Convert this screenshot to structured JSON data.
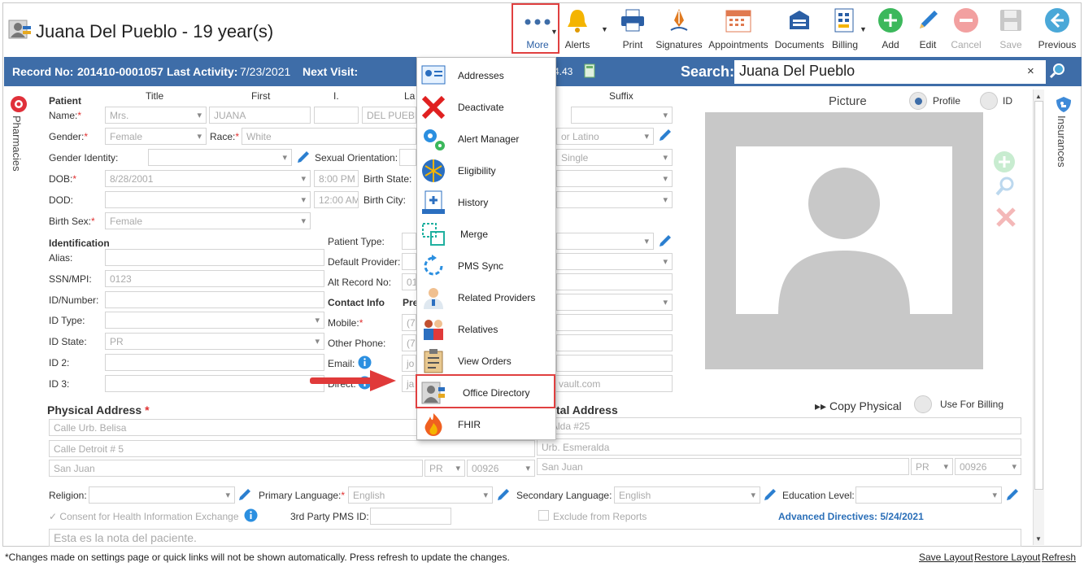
{
  "header": {
    "title": "Juana Del Pueblo - 19 year(s)"
  },
  "toolbar": {
    "more": "More",
    "alerts": "Alerts",
    "print": "Print",
    "signatures": "Signatures",
    "appointments": "Appointments",
    "documents": "Documents",
    "billing": "Billing",
    "add": "Add",
    "edit": "Edit",
    "cancel": "Cancel",
    "save": "Save",
    "previous": "Previous"
  },
  "infobar": {
    "record_label": "Record No:",
    "record_value": "201410-0001057",
    "activity_label": "Last Activity:",
    "activity_value": "7/23/2021",
    "next_label": "Next Visit:",
    "balance_tail": "4.43",
    "search_label": "Search:",
    "search_value": "Juana Del Pueblo",
    "close": "×"
  },
  "side": {
    "left": "Pharmacies",
    "right": "Insurances"
  },
  "patient": {
    "section": "Patient",
    "col_title": "Title",
    "col_first": "First",
    "col_i": "I.",
    "col_last": "La",
    "col_suffix": "Suffix",
    "name_label": "Name:",
    "title_value": "Mrs.",
    "first_value": "JUANA",
    "last_value": "DEL PUEBLO",
    "gender_label": "Gender:",
    "gender_value": "Female",
    "race_label": "Race:",
    "race_value": "White",
    "ethnicity_tail": "or Latino",
    "gender_identity_label": "Gender Identity:",
    "sexual_orientation_label": "Sexual Orientation:",
    "marital_value": "Single",
    "dob_label": "DOB:",
    "dob_value": "8/28/2001",
    "dob_time": "8:00 PM",
    "birth_state_label": "Birth State:",
    "dod_label": "DOD:",
    "dod_time": "12:00 AM",
    "birth_city_label": "Birth City:",
    "birth_sex_label": "Birth Sex:",
    "birth_sex_value": "Female"
  },
  "identification": {
    "section": "Identification",
    "alias_label": "Alias:",
    "ssn_label": "SSN/MPI:",
    "ssn_value": "0123",
    "idnumber_label": "ID/Number:",
    "idtype_label": "ID Type:",
    "idstate_label": "ID State:",
    "idstate_value": "PR",
    "id2_label": "ID 2:",
    "id3_label": "ID 3:"
  },
  "misc": {
    "patient_type_label": "Patient Type:",
    "default_provider_label": "Default Provider:",
    "alt_record_label": "Alt Record No:",
    "alt_record_tail": "01",
    "contact_label": "Contact Info",
    "contact_pref": "Pre",
    "mobile_label": "Mobile:",
    "mobile_tail": "(7",
    "other_phone_label": "Other Phone:",
    "other_phone_tail": "(7",
    "email_label": "Email:",
    "email_tail": "jo",
    "direct_label": "Direct:",
    "direct_tail": "ja",
    "direct_domain_tail": "vault.com"
  },
  "picture": {
    "label": "Picture",
    "profile": "Profile",
    "id": "ID"
  },
  "physical": {
    "label": "Physical Address",
    "line1": "Calle Urb. Belisa",
    "line2": "Calle Detroit # 5",
    "city": "San Juan",
    "state": "PR",
    "zip": "00926"
  },
  "postal": {
    "label_tail": "tal Address",
    "copy": "Copy Physical",
    "use_billing": "Use For Billing",
    "line1_tail": "le Alda #25",
    "line2": "Urb. Esmeralda",
    "city": "San Juan",
    "state": "PR",
    "zip": "00926"
  },
  "bottom": {
    "religion_label": "Religion:",
    "primary_lang_label": "Primary Language:",
    "primary_lang_value": "English",
    "secondary_lang_label": "Secondary Language:",
    "secondary_lang_value": "English",
    "education_label": "Education Level:",
    "consent": "Consent for Health Information Exchange",
    "third_party_label": "3rd Party PMS ID:",
    "exclude": "Exclude from Reports",
    "adv_directives": "Advanced Directives: 5/24/2021",
    "note": "Esta es la nota del paciente."
  },
  "menu": {
    "items": [
      "Addresses",
      "Deactivate",
      "Alert Manager",
      "Eligibility",
      "History",
      "Merge",
      "PMS Sync",
      "Related Providers",
      "Relatives",
      "View Orders",
      "Office Directory",
      "FHIR"
    ]
  },
  "footer": {
    "note": "*Changes made on settings page or quick links will not be shown automatically. Press refresh to update the changes.",
    "save_layout": "Save Layout",
    "restore_layout": "Restore Layout",
    "refresh": "Refresh"
  },
  "colors": {
    "header_blue": "#3e6da8",
    "highlight_red": "#e04040",
    "add_green": "#3cb85c"
  }
}
